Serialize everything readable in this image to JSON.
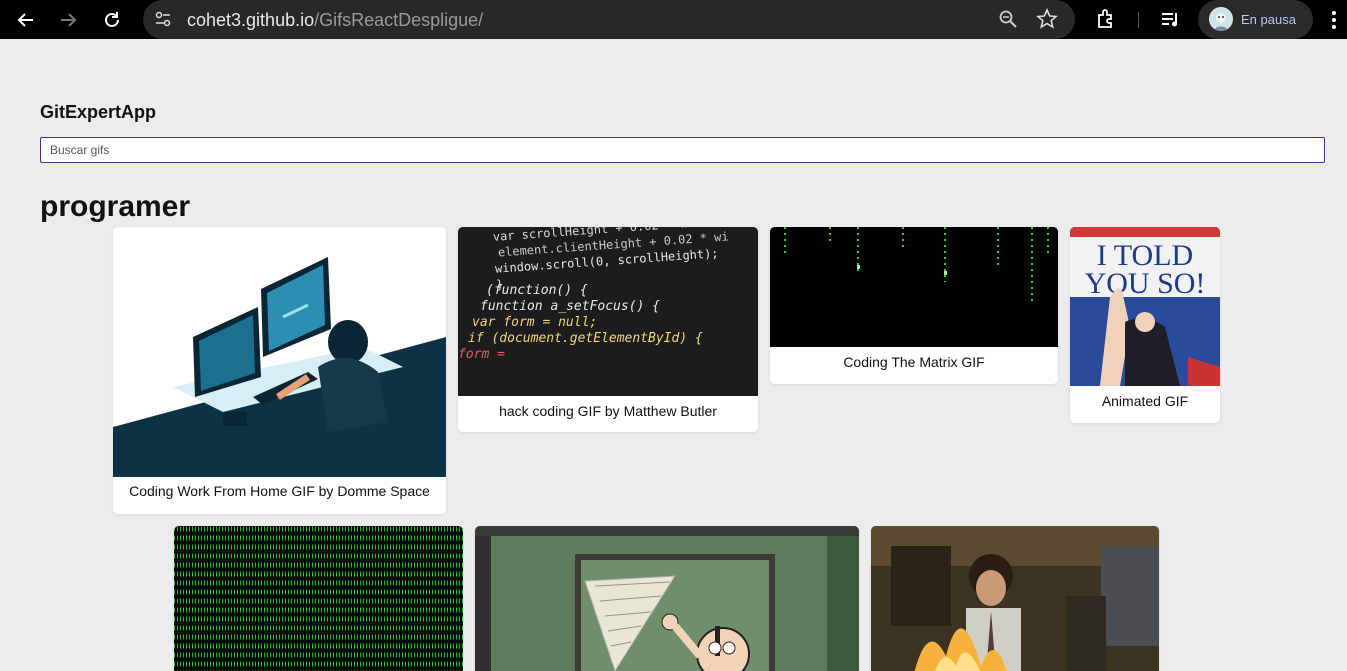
{
  "browser": {
    "url_host": "cohet3.github.io",
    "url_path": "/GifsReactDespligue/",
    "profile_label": "En pausa",
    "icons": [
      "back-arrow-icon",
      "forward-arrow-icon",
      "reload-icon",
      "site-info-icon",
      "zoom-icon",
      "bookmark-star-icon",
      "extensions-icon",
      "media-queue-icon",
      "menu-kebab-icon"
    ]
  },
  "app": {
    "title": "GitExpertApp",
    "search_placeholder": "Buscar gifs",
    "search_value": ""
  },
  "category": {
    "name": "programer"
  },
  "gifs": [
    {
      "title": "Coding Work From Home GIF by Domme Space"
    },
    {
      "title": "hack coding GIF by Matthew Butler"
    },
    {
      "title": "Coding The Matrix GIF"
    },
    {
      "title": "Animated GIF"
    },
    {
      "title": ""
    },
    {
      "title": ""
    },
    {
      "title": ""
    }
  ],
  "code_snippet": {
    "line1": "var scrollHeight + 0.02 * wi",
    "line2": "element.clientHeight + 0.02 * wi",
    "line3": "window.scroll(0, scrollHeight);",
    "line4": "}",
    "line5": "(function() {",
    "line6": "function a_setFocus() {",
    "line7": "var form = null;",
    "line8": "if (document.getElementById) {",
    "line9": "form ="
  },
  "banner_text": {
    "line1": "I TOLD",
    "line2": "YOU SO!"
  },
  "colors": {
    "page_bg": "#ececec",
    "search_border": "#4b2c8e",
    "chrome_bg": "#000000",
    "profile_text": "#aecbfa"
  }
}
